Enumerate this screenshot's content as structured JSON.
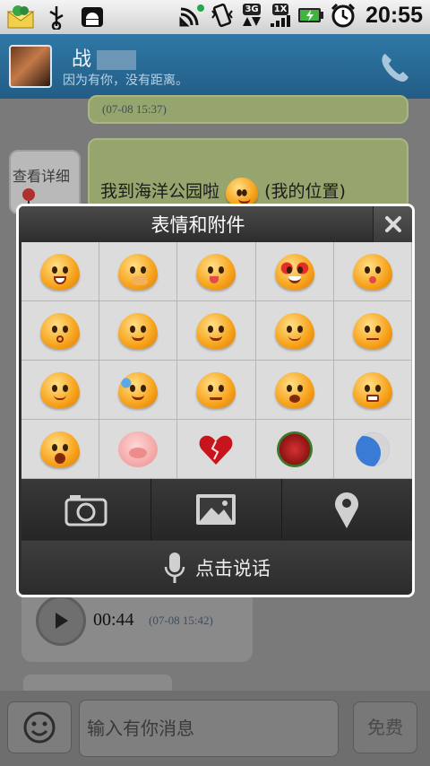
{
  "status_bar": {
    "time": "20:55",
    "network_3g": "3G",
    "network_1x": "1X",
    "icons": [
      "qq-mail-icon",
      "usb-icon",
      "android-debug-icon",
      "wifi-signal-icon",
      "vibrate-icon",
      "3g-signal-icon",
      "1x-signal-icon",
      "battery-charging-icon",
      "alarm-icon"
    ]
  },
  "header": {
    "contact_name": "战",
    "contact_status": "因为有你，没有距离。",
    "phone_icon": "phone-icon"
  },
  "chat": {
    "top_timestamp": "(07-08 15:37)",
    "map_card_label": "查看详细",
    "location_message": "我到海洋公园啦",
    "location_suffix": "(我的位置)",
    "voice_duration": "00:44",
    "voice_timestamp": "(07-08 15:42)"
  },
  "dialog": {
    "title": "表情和附件",
    "close_icon": "close-icon",
    "emojis": [
      "grin-face",
      "cover-mouth-face",
      "tongue-face",
      "heart-eyes-face",
      "kiss-face",
      "surprised-face",
      "hug-face",
      "pray-face",
      "dizzy-face",
      "worried-face",
      "sleepy-face",
      "sweat-face",
      "annoyed-face",
      "crying-face",
      "angry-face",
      "shocked-bomb-face",
      "pig-face",
      "broken-heart",
      "rose-bouquet",
      "moon-star"
    ],
    "attach_icons": [
      "camera-icon",
      "image-icon",
      "location-pin-icon"
    ],
    "voice_label": "点击说话"
  },
  "bottom_bar": {
    "input_placeholder": "输入有你消息",
    "send_label": "免费"
  }
}
